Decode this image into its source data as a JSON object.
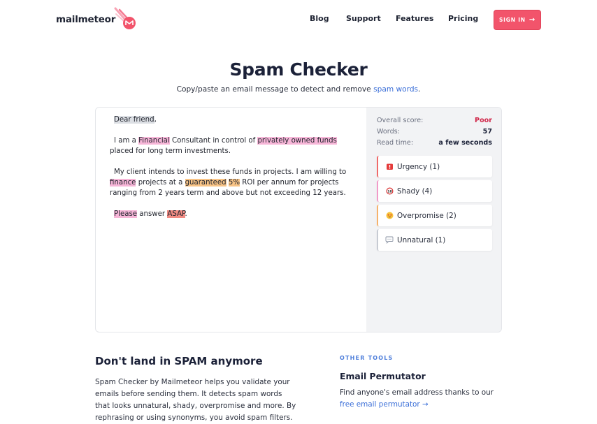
{
  "header": {
    "logo_text": "mailmeteor",
    "nav": [
      "Blog",
      "Support",
      "Features",
      "Pricing"
    ],
    "signin_label": "SIGN IN"
  },
  "hero": {
    "title": "Spam Checker",
    "subtitle_prefix": "Copy/paste an email message to detect and remove ",
    "subtitle_link": "spam words",
    "subtitle_suffix": "."
  },
  "editor": {
    "greeting": "Dear friend",
    "greeting_comma": ",",
    "p1_a": "I am a ",
    "p1_w1": "Financial",
    "p1_b": " Consultant in control of ",
    "p1_w2": "privately owned funds",
    "p1_c": " placed for long term investments.",
    "p2_a": "My client intends to invest these funds in projects. I am willing to ",
    "p2_w1": "finance",
    "p2_b": " projects at a ",
    "p2_w2": "guaranteed",
    "p2_sp": " ",
    "p2_w3": "5%",
    "p2_c": " ROI per annum for projects ranging from 2 years term and above but not exceeding 12 years.",
    "p3_w1": "Please",
    "p3_a": " answer ",
    "p3_w2": "ASAP",
    "p3_b": "."
  },
  "panel": {
    "overall_label": "Overall score:",
    "overall_value": "Poor",
    "words_label": "Words:",
    "words_value": "57",
    "read_label": "Read time:",
    "read_value": "a few seconds",
    "categories": [
      {
        "label": "Urgency (1)",
        "icon": "alarm-icon",
        "color": "#f06a6a"
      },
      {
        "label": "Shady (4)",
        "icon": "no-entry-18-icon",
        "color": "#f29ac8"
      },
      {
        "label": "Overpromise (2)",
        "icon": "star-struck-icon",
        "color": "#f6b26b"
      },
      {
        "label": "Unnatural (1)",
        "icon": "speech-bubble-icon",
        "color": "#c7cbd3"
      }
    ]
  },
  "info": {
    "heading": "Don't land in SPAM anymore",
    "paragraph": "Spam Checker by Mailmeteor helps you validate your emails before sending them. It detects spam words that looks unnatural, shady, overpromise and more. By rephrasing or using synonyms, you avoid spam filters.",
    "other_tools_label": "OTHER TOOLS",
    "tool_title": "Email Permutator",
    "tool_desc": "Find anyone's email address thanks to our ",
    "tool_link": "free email permutator"
  },
  "colors": {
    "accent": "#f2546b",
    "link": "#3b6fd8",
    "poor": "#d0294b"
  }
}
